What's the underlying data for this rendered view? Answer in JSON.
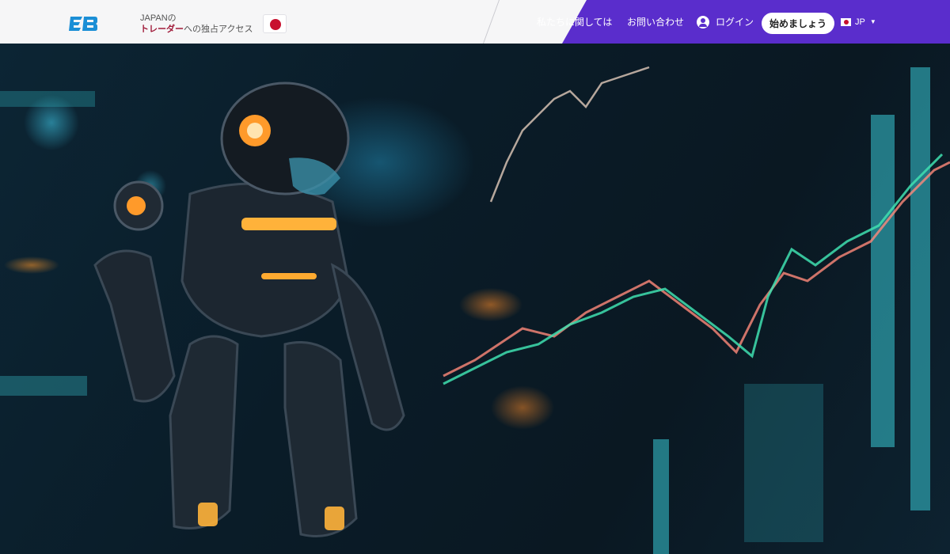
{
  "header": {
    "logo_icon": "eb-logo-icon",
    "tagline_line1": "JAPANの",
    "tagline_highlight": "トレーダー",
    "tagline_rest": "への独占アクセス",
    "country_flag_icon": "japan-flag-icon"
  },
  "nav": {
    "about": "私たちに関しては",
    "contact": "お問い合わせ",
    "login": "ログイン",
    "start": "始めましょう",
    "lang": "JP"
  },
  "colors": {
    "accent": "#5a2dcc",
    "highlight": "#a01b3a",
    "chart_green": "#3fe0b0",
    "chart_red": "#ff8a7a"
  },
  "hero": {
    "image_icon": "robot-trading-hero-image"
  }
}
